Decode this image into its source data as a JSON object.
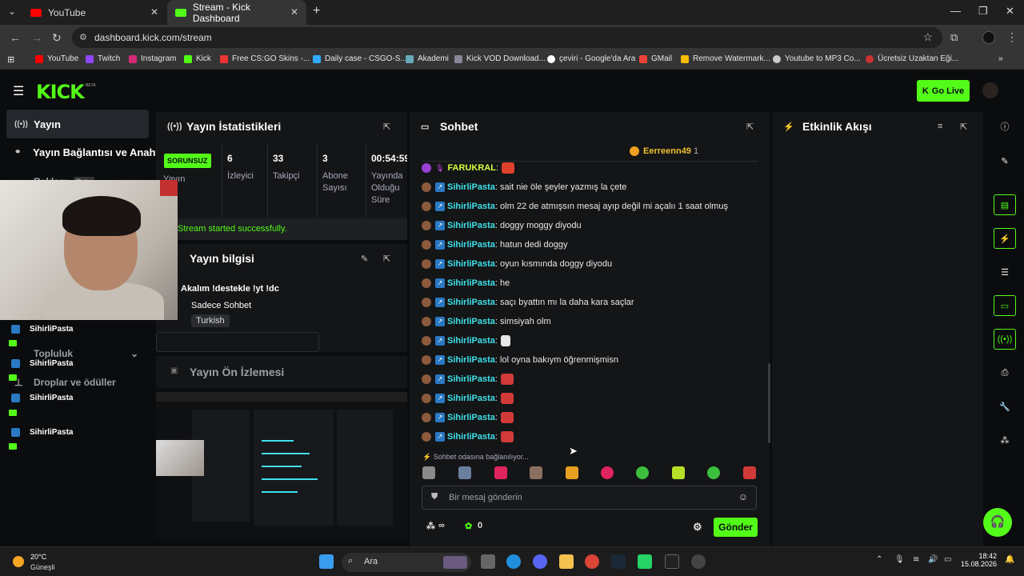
{
  "browser": {
    "tabs": [
      {
        "label": "YouTube",
        "active": false
      },
      {
        "label": "Stream - Kick Dashboard",
        "active": true
      }
    ],
    "url": "dashboard.kick.com/stream",
    "bookmarks": [
      "YouTube",
      "Twitch",
      "Instagram",
      "Kick",
      "Free CS:GO Skins -...",
      "Daily case - CSGO-S...",
      "Akademi",
      "Kick VOD Download...",
      "çeviri - Google'da Ara",
      "GMail",
      "Remove Watermark...",
      "Youtube to MP3 Co...",
      "Ücretsiz Uzaktan Eği..."
    ]
  },
  "header": {
    "logo": "KICK",
    "beta": "BETA",
    "go_live": "Go Live"
  },
  "sidebar": {
    "items": [
      {
        "label": "Yayın",
        "selected": true
      },
      {
        "label": "Yayın Bağlantısı ve Anahtar",
        "selected": false
      }
    ],
    "dim_items": [
      "Reklam",
      "Beta",
      "Topluluk",
      "Droplar ve ödüller"
    ]
  },
  "stats": {
    "title": "Yayın İstatistikleri",
    "badge": "SORUNSUZ",
    "badge_caption": "Yayın",
    "items": [
      {
        "value": "6",
        "label": "İzleyici"
      },
      {
        "value": "33",
        "label": "Takipçi"
      },
      {
        "value": "3",
        "label": "Abone Sayısı"
      },
      {
        "value": "00:54:59",
        "label": "Yayında Olduğu Süre"
      }
    ],
    "status": "Stream started successfully."
  },
  "info": {
    "title": "Yayın bilgisi",
    "stream_title": "Akalım !destekle !yt !dc",
    "category": "Sadece Sohbet",
    "language": "Turkish"
  },
  "preview": {
    "title": "Yayın Ön İzlemesi"
  },
  "chat": {
    "title": "Sohbet",
    "pinned_sub_user": "Eerreenn49",
    "pinned_sub_count": "1",
    "messages": [
      {
        "user": "FARUKRAL",
        "text": ""
      },
      {
        "user": "SihirliPasta",
        "text": "sait nie öle şeyler yazmış la çete"
      },
      {
        "user": "SihirliPasta",
        "text": "olm 22 de atmışsın mesaj ayıp değil mi açalıı 1 saat olmuş"
      },
      {
        "user": "SihirliPasta",
        "text": "doggy moggy diyodu"
      },
      {
        "user": "SihirliPasta",
        "text": "hatun dedi doggy"
      },
      {
        "user": "SihirliPasta",
        "text": "oyun kısmında doggy diyodu"
      },
      {
        "user": "SihirliPasta",
        "text": "he"
      },
      {
        "user": "SihirliPasta",
        "text": "saçı byattın mı la daha kara saçlar"
      },
      {
        "user": "SihirliPasta",
        "text": "simsiyah olm"
      },
      {
        "user": "SihirliPasta",
        "text": ""
      },
      {
        "user": "SihirliPasta",
        "text": "lol oyna bakıym öğrenmişmisn"
      },
      {
        "user": "SihirliPasta",
        "text": ""
      },
      {
        "user": "SihirliPasta",
        "text": ""
      },
      {
        "user": "SihirliPasta",
        "text": ""
      },
      {
        "user": "SihirliPasta",
        "text": ""
      }
    ],
    "connecting": "Sohbet odasına bağlanılıyor...",
    "input_placeholder": "Bir mesaj gönderin",
    "infinity": "∞",
    "points": "0",
    "send": "Gönder"
  },
  "activity": {
    "title": "Etkinlik Akışı"
  },
  "overlay": {
    "names": [
      "SihirliPasta",
      "SihirliPasta",
      "SihirliPasta",
      "SihirliPasta"
    ]
  },
  "taskbar": {
    "temp": "20°C",
    "weather": "Güneşli",
    "search": "Ara",
    "time": "18:42",
    "date": "15.08.2026"
  }
}
